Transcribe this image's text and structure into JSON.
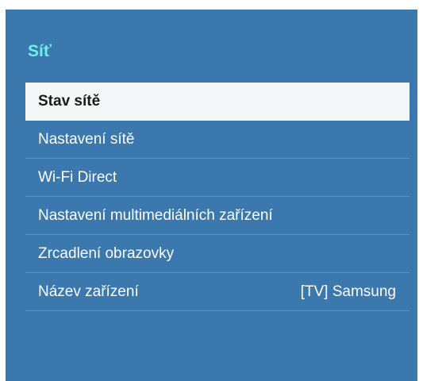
{
  "panel": {
    "title": "Síť",
    "accent_color": "#6ff0e6",
    "background_color": "#3a78ad"
  },
  "menu": {
    "items": [
      {
        "label": "Stav sítě",
        "value": "",
        "selected": true
      },
      {
        "label": "Nastavení sítě",
        "value": ""
      },
      {
        "label": "Wi-Fi Direct",
        "value": ""
      },
      {
        "label": "Nastavení multimediálních zařízení",
        "value": ""
      },
      {
        "label": "Zrcadlení obrazovky",
        "value": ""
      },
      {
        "label": "Název zařízení",
        "value": "[TV] Samsung"
      }
    ]
  }
}
